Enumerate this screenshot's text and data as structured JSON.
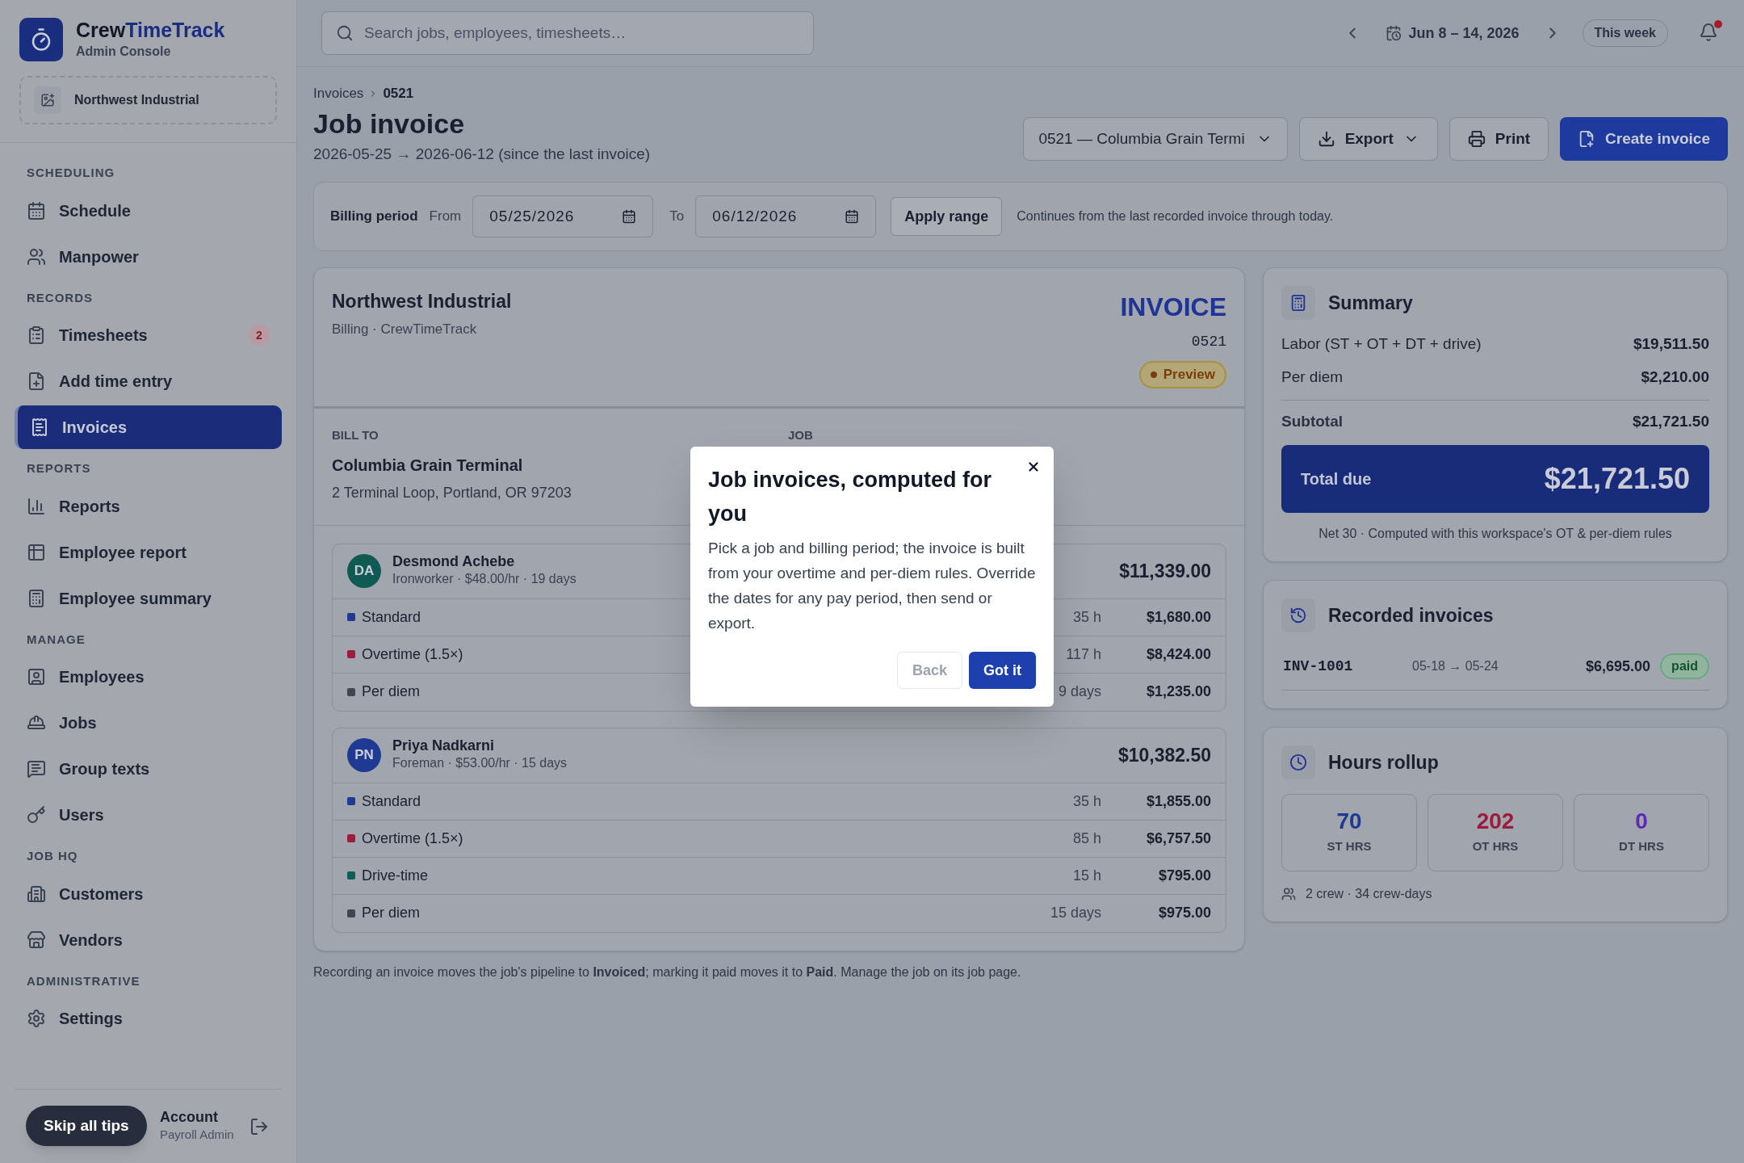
{
  "brand": {
    "name_first": "Crew",
    "name_second": "TimeTrack",
    "subtitle": "Admin Console"
  },
  "workspace": "Northwest Industrial",
  "nav_sections": [
    {
      "title": "SCHEDULING",
      "items": [
        {
          "label": "Schedule",
          "selected": false
        },
        {
          "label": "Manpower",
          "selected": false
        }
      ]
    },
    {
      "title": "RECORDS",
      "items": [
        {
          "label": "Timesheets",
          "selected": false,
          "badge": "2"
        },
        {
          "label": "Add time entry",
          "selected": false
        },
        {
          "label": "Invoices",
          "selected": true
        }
      ]
    },
    {
      "title": "REPORTS",
      "items": [
        {
          "label": "Reports",
          "selected": false
        },
        {
          "label": "Employee report",
          "selected": false
        },
        {
          "label": "Employee summary",
          "selected": false
        }
      ]
    },
    {
      "title": "MANAGE",
      "items": [
        {
          "label": "Employees",
          "selected": false
        },
        {
          "label": "Jobs",
          "selected": false
        },
        {
          "label": "Group texts",
          "selected": false
        },
        {
          "label": "Users",
          "selected": false
        }
      ]
    },
    {
      "title": "JOB HQ",
      "items": [
        {
          "label": "Customers",
          "selected": false
        },
        {
          "label": "Vendors",
          "selected": false
        }
      ]
    },
    {
      "title": "ADMINISTRATIVE",
      "items": [
        {
          "label": "Settings",
          "selected": false
        }
      ]
    }
  ],
  "account": {
    "name": "Account",
    "role": "Payroll Admin"
  },
  "skip_tips": "Skip all tips",
  "topbar": {
    "search_placeholder": "Search jobs, employees, timesheets…",
    "date_range": "Jun 8 – 14, 2026",
    "this_week": "This week",
    "unread": true
  },
  "page": {
    "breadcrumb": [
      "Invoices",
      "0521"
    ],
    "title": "Job invoice",
    "subtitle": "2026-05-25 → 2026-06-12 (since the last invoice)",
    "job_select": "0521 — Columbia Grain Termi",
    "export": "Export",
    "print": "Print",
    "create": "Create invoice"
  },
  "billing": {
    "label": "Billing period",
    "from_label": "From",
    "from": "05/25/2026",
    "to_label": "To",
    "to": "06/12/2026",
    "apply": "Apply range",
    "note": "Continues from the last recorded invoice through today."
  },
  "invoice": {
    "company": "Northwest Industrial",
    "company_sub": "Billing · CrewTimeTrack",
    "heading": "INVOICE",
    "number": "0521",
    "status": "Preview",
    "bill_to_label": "BILL TO",
    "customer": "Columbia Grain Terminal",
    "address": "2 Terminal Loop, Portland, OR 97203",
    "job_label": "JOB",
    "employees": [
      {
        "initials": "DA",
        "color": "#0f5a52",
        "name": "Desmond Achebe",
        "detail": "Ironworker · $48.00/hr · 19 days",
        "total": "$11,339.00",
        "lines": [
          {
            "label": "Standard",
            "color": "#1f3a93",
            "qty": "35 h",
            "amount": "$1,680.00"
          },
          {
            "label": "Overtime (1.5×)",
            "color": "#9b1c3c",
            "qty": "117 h",
            "amount": "$8,424.00"
          },
          {
            "label": "Per diem",
            "color": "#3f4654",
            "qty": "9 days",
            "amount": "$1,235.00"
          }
        ]
      },
      {
        "initials": "PN",
        "color": "#1f3a93",
        "name": "Priya Nadkarni",
        "detail": "Foreman · $53.00/hr · 15 days",
        "total": "$10,382.50",
        "lines": [
          {
            "label": "Standard",
            "color": "#1f3a93",
            "qty": "35 h",
            "amount": "$1,855.00"
          },
          {
            "label": "Overtime (1.5×)",
            "color": "#9b1c3c",
            "qty": "85 h",
            "amount": "$6,757.50"
          },
          {
            "label": "Drive-time",
            "color": "#0f5e5a",
            "qty": "15 h",
            "amount": "$795.00"
          },
          {
            "label": "Per diem",
            "color": "#3f4654",
            "qty": "15 days",
            "amount": "$975.00"
          }
        ]
      }
    ]
  },
  "footer_note": "Recording an invoice moves the job's pipeline to **Invoiced**; marking it paid moves it to **Paid**. Manage the job on its job page.",
  "summary": {
    "title": "Summary",
    "rows": [
      {
        "kind": "line",
        "label": "Labor (ST + OT + DT + drive)",
        "value": "$19,511.50"
      },
      {
        "kind": "line",
        "label": "Per diem",
        "value": "$2,210.00"
      },
      {
        "kind": "subtotal",
        "label": "Subtotal",
        "value": "$21,721.50"
      }
    ],
    "total_label": "Total due",
    "total": "$21,721.50",
    "note": "Net 30 · Computed with this workspace's OT & per-diem rules"
  },
  "recorded": {
    "title": "Recorded invoices",
    "items": [
      {
        "id": "INV-1001",
        "range": "05-18 → 05-24",
        "amount": "$6,695.00",
        "status": "paid"
      }
    ]
  },
  "rollup": {
    "title": "Hours rollup",
    "stats": [
      {
        "value": "70",
        "label": "ST HRS",
        "color": "#1f3a93"
      },
      {
        "value": "202",
        "label": "OT HRS",
        "color": "#9b1c3c"
      },
      {
        "value": "0",
        "label": "DT HRS",
        "color": "#5b2bb5"
      }
    ],
    "crew": "2 crew · 34 crew-days"
  },
  "tip": {
    "title": "Job invoices, computed for you",
    "body": "Pick a job and billing period; the invoice is built from your overtime and per-diem rules. Override the dates for any pay period, then send or export.",
    "back": "Back",
    "back_disabled": true,
    "primary": "Got it"
  }
}
